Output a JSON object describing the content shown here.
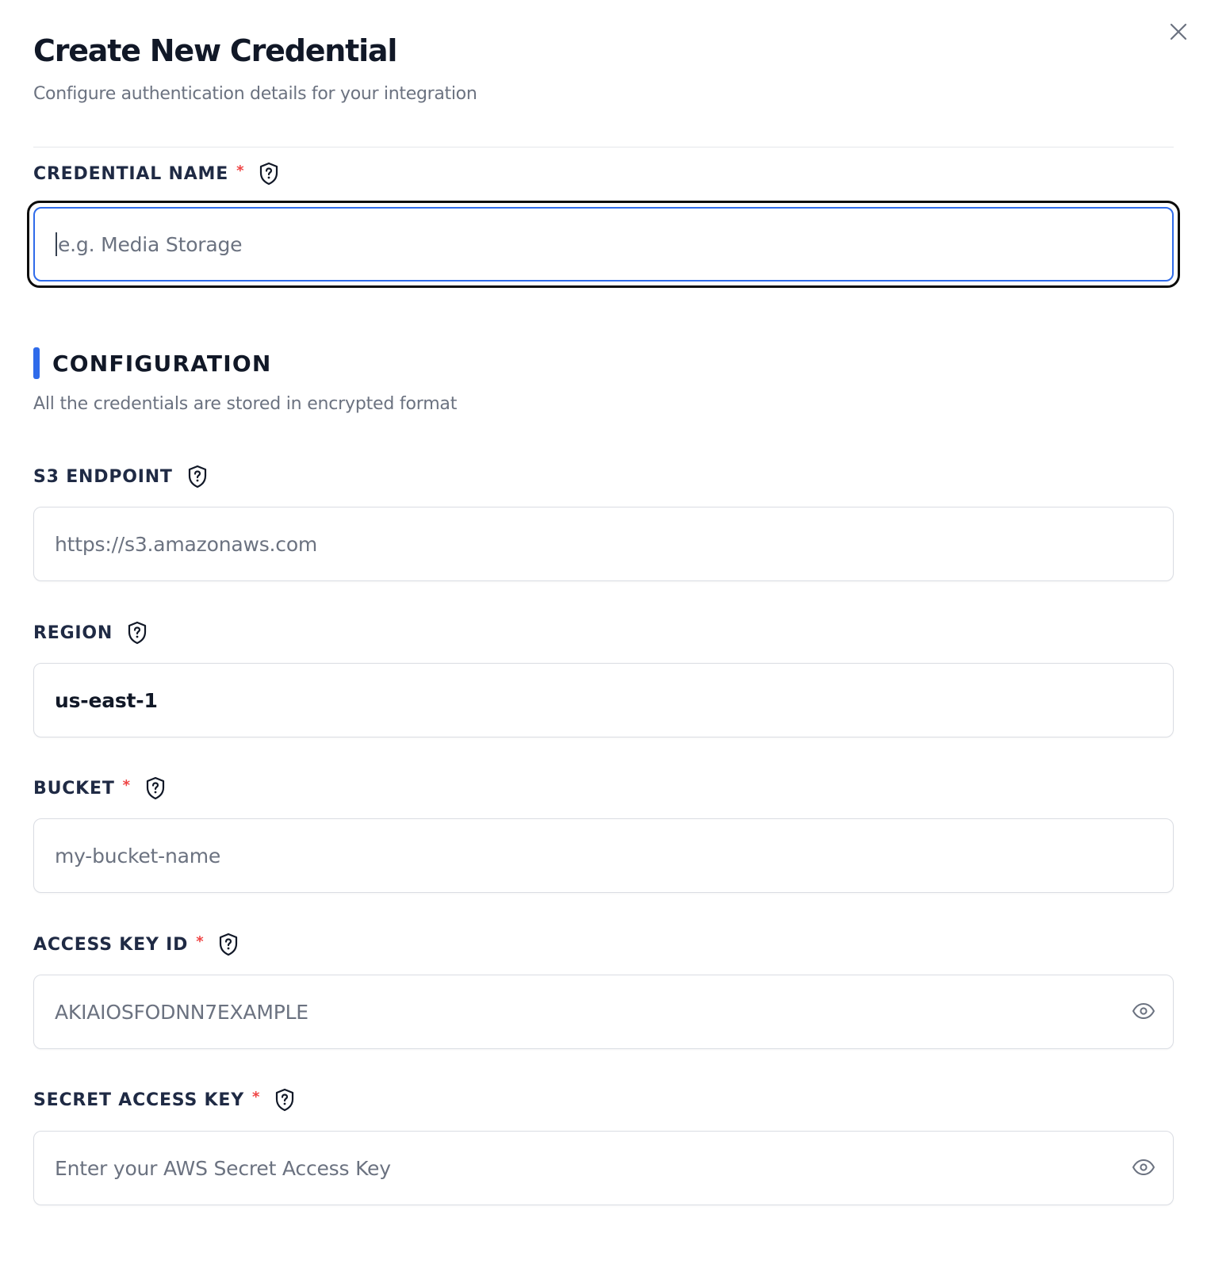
{
  "dialog": {
    "title": "Create New Credential",
    "subtitle": "Configure authentication details for your integration"
  },
  "credential_name": {
    "label": "CREDENTIAL NAME",
    "required_mark": "*",
    "placeholder": "e.g. Media Storage",
    "value": ""
  },
  "configuration": {
    "title": "CONFIGURATION",
    "description": "All the credentials are stored in encrypted format",
    "accent_color": "#2f6bea"
  },
  "fields": {
    "s3_endpoint": {
      "label": "S3 ENDPOINT",
      "placeholder": "https://s3.amazonaws.com",
      "value": ""
    },
    "region": {
      "label": "REGION",
      "value": "us-east-1"
    },
    "bucket": {
      "label": "BUCKET",
      "required_mark": "*",
      "placeholder": "my-bucket-name",
      "value": ""
    },
    "access_key_id": {
      "label": "ACCESS KEY ID",
      "required_mark": "*",
      "placeholder": "AKIAIOSFODNN7EXAMPLE",
      "value": ""
    },
    "secret_access_key": {
      "label": "SECRET ACCESS KEY",
      "required_mark": "*",
      "placeholder": "Enter your AWS Secret Access Key",
      "value": ""
    }
  },
  "icons": {
    "close": "close-icon",
    "help": "shield-question-icon",
    "visibility": "eye-icon"
  },
  "colors": {
    "required": "#ef4444",
    "focus_border": "#2f6bea",
    "label": "#1f2a44",
    "muted": "#6b7280"
  }
}
